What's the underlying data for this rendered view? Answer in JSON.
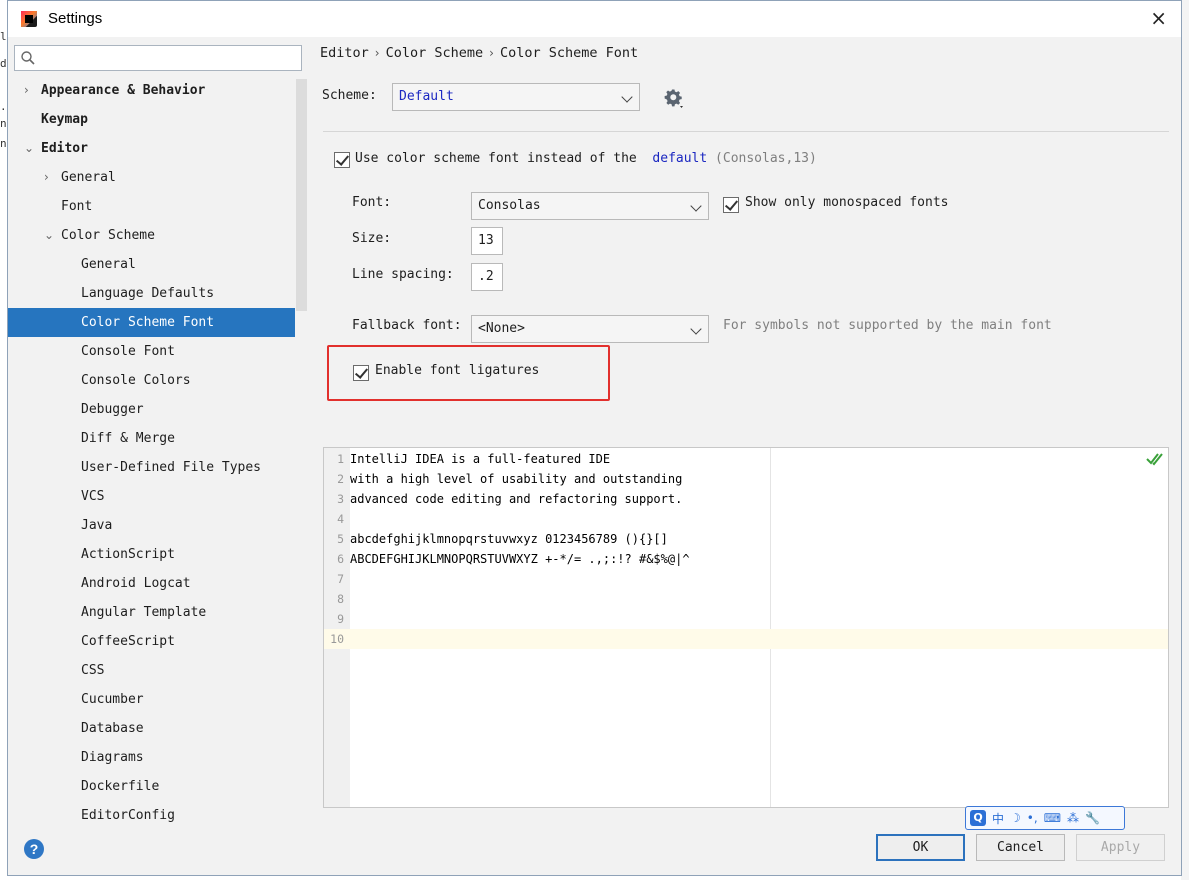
{
  "window": {
    "title": "Settings",
    "close_glyph": "×"
  },
  "sidebar": {
    "search_placeholder": "",
    "items": [
      {
        "label": "Appearance & Behavior",
        "arrow": "›",
        "bold": true
      },
      {
        "label": "Keymap",
        "arrow": "",
        "bold": true
      },
      {
        "label": "Editor",
        "arrow": "⌄",
        "bold": true
      },
      {
        "label": "General",
        "arrow": "›"
      },
      {
        "label": "Font",
        "arrow": ""
      },
      {
        "label": "Color Scheme",
        "arrow": "⌄"
      },
      {
        "label": "General"
      },
      {
        "label": "Language Defaults"
      },
      {
        "label": "Color Scheme Font",
        "selected": true
      },
      {
        "label": "Console Font"
      },
      {
        "label": "Console Colors"
      },
      {
        "label": "Debugger"
      },
      {
        "label": "Diff & Merge"
      },
      {
        "label": "User-Defined File Types"
      },
      {
        "label": "VCS"
      },
      {
        "label": "Java"
      },
      {
        "label": "ActionScript"
      },
      {
        "label": "Android Logcat"
      },
      {
        "label": "Angular Template"
      },
      {
        "label": "CoffeeScript"
      },
      {
        "label": "CSS"
      },
      {
        "label": "Cucumber"
      },
      {
        "label": "Database"
      },
      {
        "label": "Diagrams"
      },
      {
        "label": "Dockerfile"
      },
      {
        "label": "EditorConfig"
      }
    ]
  },
  "breadcrumb": [
    "Editor",
    "Color Scheme",
    "Color Scheme Font"
  ],
  "breadcrumb_sep": "›",
  "scheme": {
    "label": "Scheme:",
    "value": "Default"
  },
  "use_scheme_font": {
    "label": "Use color scheme font instead of the",
    "link": "default",
    "hint": "(Consolas,13)",
    "checked": true
  },
  "font": {
    "label": "Font:",
    "value": "Consolas"
  },
  "monospaced": {
    "label": "Show only monospaced fonts",
    "checked": true
  },
  "size": {
    "label": "Size:",
    "value": "13"
  },
  "line_spacing": {
    "label": "Line spacing:",
    "value": ".2"
  },
  "fallback": {
    "label": "Fallback font:",
    "value": "<None>",
    "hint": "For symbols not supported by the main font"
  },
  "ligatures": {
    "label": "Enable font ligatures",
    "checked": true
  },
  "preview": {
    "lines": [
      {
        "n": "1",
        "text": "IntelliJ IDEA is a full-featured IDE"
      },
      {
        "n": "2",
        "text": "with a high level of usability and outstanding"
      },
      {
        "n": "3",
        "text": "advanced code editing and refactoring support."
      },
      {
        "n": "4",
        "text": ""
      },
      {
        "n": "5",
        "text": "abcdefghijklmnopqrstuvwxyz 0123456789 (){}[]"
      },
      {
        "n": "6",
        "text": "ABCDEFGHIJKLMNOPQRSTUVWXYZ +-*/= .,;:!? #&$%@|^"
      },
      {
        "n": "7",
        "text": ""
      },
      {
        "n": "8",
        "text": ""
      },
      {
        "n": "9",
        "text": ""
      },
      {
        "n": "10",
        "text": "",
        "caret": true
      }
    ]
  },
  "buttons": {
    "ok": "OK",
    "cancel": "Cancel",
    "apply": "Apply",
    "help": "?"
  },
  "ime": {
    "logo": "Q",
    "items": [
      "中",
      "☽",
      "•,",
      "⌨",
      "⁂",
      "🔧"
    ]
  },
  "colors": {
    "selection": "#2675bf",
    "highlight_border": "#e2302d",
    "link": "#1b27c1",
    "caret_row": "#fffbe9"
  }
}
